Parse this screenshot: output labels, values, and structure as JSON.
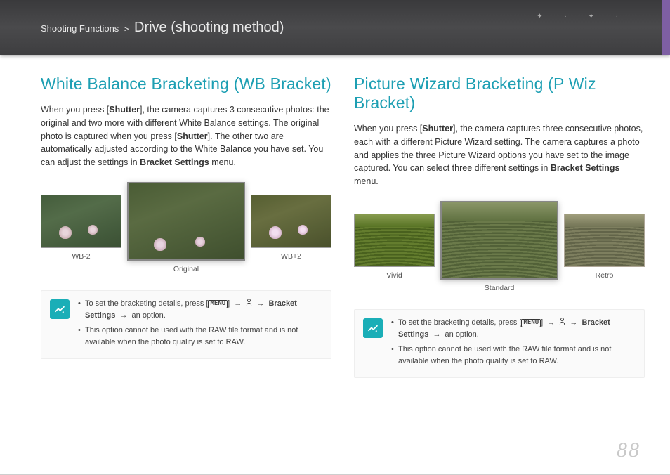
{
  "header": {
    "breadcrumb_section": "Shooting Functions",
    "breadcrumb_sep": ">",
    "breadcrumb_current": "Drive (shooting method)"
  },
  "page_number": "88",
  "left": {
    "heading": "White Balance Bracketing (WB Bracket)",
    "body_pre": "When you press [",
    "body_shutter1": "Shutter",
    "body_mid1": "], the camera captures 3 consecutive photos: the original and two more with different White Balance settings. The original photo is captured when you press [",
    "body_shutter2": "Shutter",
    "body_mid2": "]. The other two are automatically adjusted according to the White Balance you have set. You can adjust the settings in ",
    "body_bold_bs": "Bracket Settings",
    "body_post": " menu.",
    "captions": {
      "a": "WB-2",
      "b": "Original",
      "c": "WB+2"
    },
    "note": {
      "li1_pre": "To set the bracketing details, press [",
      "li1_menu": "MENU",
      "li1_mid1": "] ",
      "li1_arrow": "→",
      "li1_bs": "Bracket Settings",
      "li1_post": " an option.",
      "li2": "This option cannot be used with the RAW file format and is not available when the photo quality is set to RAW."
    }
  },
  "right": {
    "heading": "Picture Wizard Bracketing (P Wiz Bracket)",
    "body_pre": "When you press [",
    "body_shutter1": "Shutter",
    "body_mid1": "], the camera captures three consecutive photos, each with a different Picture Wizard setting. The camera captures a photo and applies the three Picture Wizard options you have set to the image captured. You can select three different settings in ",
    "body_bold_bs": "Bracket Settings",
    "body_post": " menu.",
    "captions": {
      "a": "Vivid",
      "b": "Standard",
      "c": "Retro"
    },
    "note": {
      "li1_pre": "To set the bracketing details, press [",
      "li1_menu": "MENU",
      "li1_mid1": "] ",
      "li1_arrow": "→",
      "li1_bs": "Bracket Settings",
      "li1_post": " an option.",
      "li2": "This option cannot be used with the RAW file format and is not available when the photo quality is set to RAW."
    }
  }
}
